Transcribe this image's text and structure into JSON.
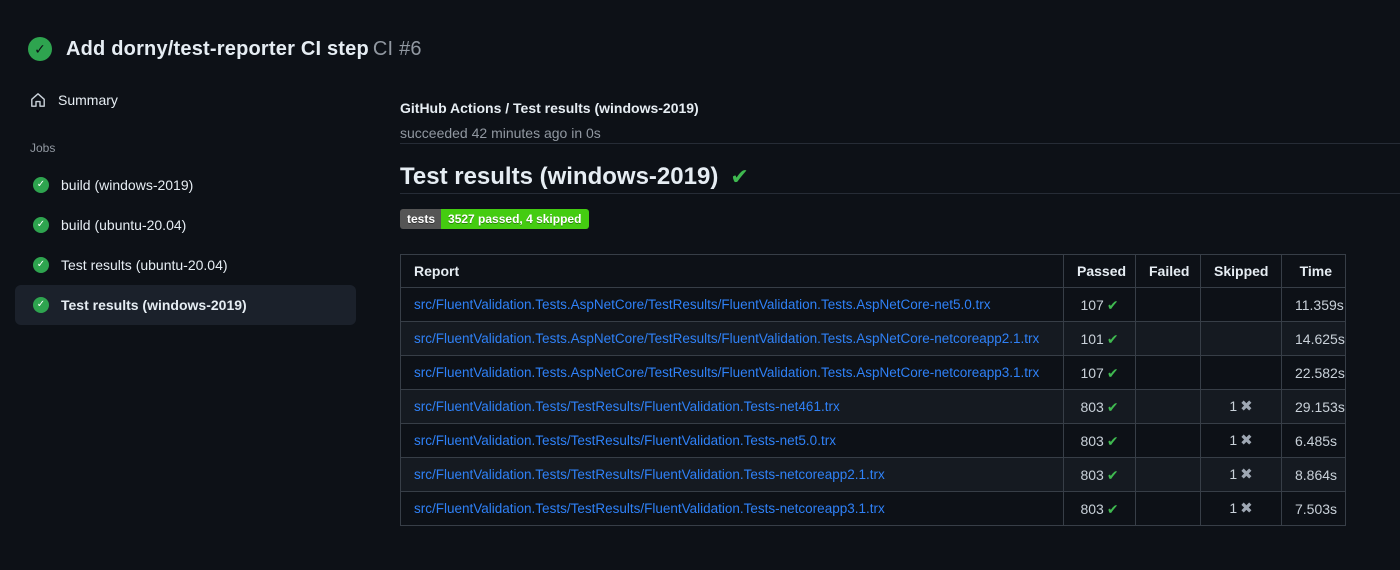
{
  "header": {
    "title": "Add dorny/test-reporter CI step",
    "run_number": "CI #6"
  },
  "sidebar": {
    "summary_label": "Summary",
    "jobs_label": "Jobs",
    "jobs": [
      {
        "label": "build (windows-2019)",
        "selected": false
      },
      {
        "label": "build (ubuntu-20.04)",
        "selected": false
      },
      {
        "label": "Test results (ubuntu-20.04)",
        "selected": false
      },
      {
        "label": "Test results (windows-2019)",
        "selected": true
      }
    ]
  },
  "main": {
    "check_title": "GitHub Actions / Test results (windows-2019)",
    "check_status": "succeeded 42 minutes ago in 0s",
    "section_heading": "Test results (windows-2019)",
    "badge": {
      "label": "tests",
      "value": "3527 passed, 4 skipped"
    },
    "table": {
      "columns": [
        "Report",
        "Passed",
        "Failed",
        "Skipped",
        "Time"
      ],
      "rows": [
        {
          "report": "src/FluentValidation.Tests.AspNetCore/TestResults/FluentValidation.Tests.AspNetCore-net5.0.trx",
          "passed": "107",
          "failed": "",
          "skipped": "",
          "time": "11.359s"
        },
        {
          "report": "src/FluentValidation.Tests.AspNetCore/TestResults/FluentValidation.Tests.AspNetCore-netcoreapp2.1.trx",
          "passed": "101",
          "failed": "",
          "skipped": "",
          "time": "14.625s"
        },
        {
          "report": "src/FluentValidation.Tests.AspNetCore/TestResults/FluentValidation.Tests.AspNetCore-netcoreapp3.1.trx",
          "passed": "107",
          "failed": "",
          "skipped": "",
          "time": "22.582s"
        },
        {
          "report": "src/FluentValidation.Tests/TestResults/FluentValidation.Tests-net461.trx",
          "passed": "803",
          "failed": "",
          "skipped": "1",
          "time": "29.153s"
        },
        {
          "report": "src/FluentValidation.Tests/TestResults/FluentValidation.Tests-net5.0.trx",
          "passed": "803",
          "failed": "",
          "skipped": "1",
          "time": "6.485s"
        },
        {
          "report": "src/FluentValidation.Tests/TestResults/FluentValidation.Tests-netcoreapp2.1.trx",
          "passed": "803",
          "failed": "",
          "skipped": "1",
          "time": "8.864s"
        },
        {
          "report": "src/FluentValidation.Tests/TestResults/FluentValidation.Tests-netcoreapp3.1.trx",
          "passed": "803",
          "failed": "",
          "skipped": "1",
          "time": "7.503s"
        }
      ]
    }
  },
  "icons": {
    "check_glyph": "✓",
    "pass_glyph": "✔",
    "skip_glyph": "✖"
  },
  "colors": {
    "page-bg": "#0d1117",
    "text-primary": "#e6edf3",
    "text-secondary": "#c9d1d9",
    "text-muted": "#9198a1",
    "accent-green": "#3fb950",
    "circle-green": "#2ea44f",
    "link-blue": "#2f81f7",
    "badge-label-bg": "#555555",
    "badge-value-bg": "#44cc11",
    "selected-bg": "#1b212b",
    "divider": "#262c36",
    "table-border": "#373e47",
    "row-alt-bg": "#151a21",
    "skip-gray": "#9ea7b3"
  }
}
